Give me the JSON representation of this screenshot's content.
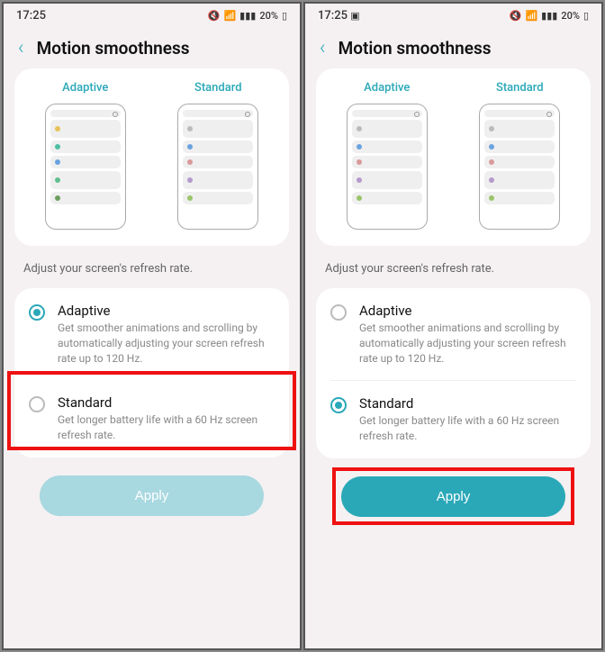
{
  "status": {
    "time": "17:25",
    "battery": "20%"
  },
  "header": {
    "title": "Motion smoothness"
  },
  "preview": {
    "adaptive_label": "Adaptive",
    "standard_label": "Standard"
  },
  "description": "Adjust your screen's refresh rate.",
  "options": {
    "adaptive": {
      "title": "Adaptive",
      "desc": "Get smoother animations and scrolling by automatically adjusting your screen refresh rate up to 120 Hz."
    },
    "standard": {
      "title": "Standard",
      "desc": "Get longer battery life with a 60 Hz screen refresh rate."
    }
  },
  "apply_label": "Apply",
  "colors": {
    "adaptive_dots": [
      "#e8c25a",
      "#4dbfa2",
      "#6aa2e0",
      "#5fbf8f",
      "#6d9f5f"
    ],
    "standard_dots": [
      "#bbb",
      "#6aa2e0",
      "#d99a9a",
      "#b59acc",
      "#9bc46b"
    ]
  }
}
